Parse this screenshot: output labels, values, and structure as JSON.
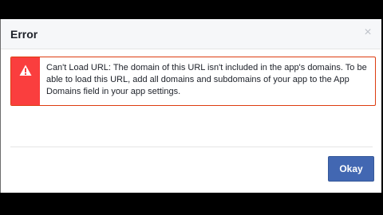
{
  "dialog": {
    "title": "Error",
    "close_icon": "close-icon",
    "error": {
      "icon": "warning-icon",
      "message": "Can't Load URL: The domain of this URL isn't included in the app's domains. To be able to load this URL, add all domains and subdomains of your app to the App Domains field in your app settings."
    },
    "okay_label": "Okay"
  },
  "colors": {
    "error_red": "#fa3e3e",
    "error_border": "#dd3c10",
    "button_blue": "#4267b2",
    "header_bg": "#f6f7f9"
  }
}
